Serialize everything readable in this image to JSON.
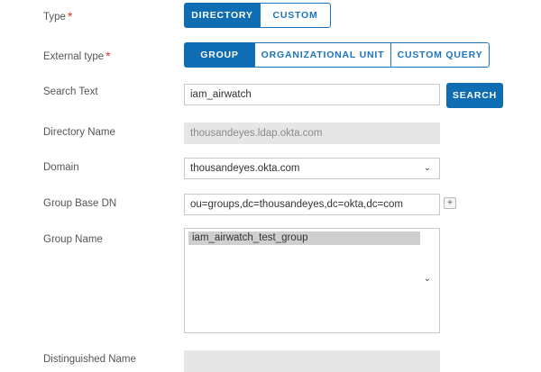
{
  "type": {
    "label": "Type",
    "required_mark": "*",
    "options": [
      "DIRECTORY",
      "CUSTOM"
    ],
    "selected": "DIRECTORY"
  },
  "external_type": {
    "label": "External type",
    "required_mark": "*",
    "options": [
      "GROUP",
      "ORGANIZATIONAL UNIT",
      "CUSTOM QUERY"
    ],
    "selected": "GROUP"
  },
  "search_text": {
    "label": "Search Text",
    "value": "iam_airwatch",
    "button_label": "SEARCH"
  },
  "directory_name": {
    "label": "Directory Name",
    "value": "thousandeyes.ldap.okta.com"
  },
  "domain": {
    "label": "Domain",
    "value": "thousandeyes.okta.com"
  },
  "group_base_dn": {
    "label": "Group Base DN",
    "value": "ou=groups,dc=thousandeyes,dc=okta,dc=com",
    "add_label": "+"
  },
  "group_name": {
    "label": "Group Name",
    "items": [
      "iam_airwatch_test_group"
    ]
  },
  "distinguished_name": {
    "label": "Distinguished Name"
  },
  "colors": {
    "primary": "#0f6db3",
    "required": "#d9372b",
    "readonly_bg": "#e6e6e6"
  }
}
